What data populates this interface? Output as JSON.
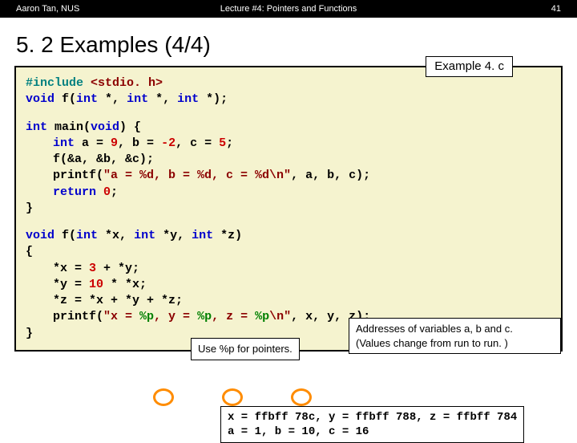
{
  "header": {
    "left": "Aaron Tan, NUS",
    "center": "Lecture #4: Pointers and Functions",
    "right": "41"
  },
  "title": "5. 2 Examples (4/4)",
  "example_label": "Example 4. c",
  "code": {
    "l1a": "#include ",
    "l1b": "<stdio. h>",
    "l2a": "void",
    "l2b": " f(",
    "l2c": "int",
    "l2d": " *, ",
    "l2e": "int",
    "l2f": " *, ",
    "l2g": "int",
    "l2h": " *);",
    "l3a": "int",
    "l3b": " main(",
    "l3c": "void",
    "l3d": ") {",
    "l4a": "int",
    "l4b": " a = ",
    "l4c": "9",
    "l4d": ", b = ",
    "l4e": "-2",
    "l4f": ", c = ",
    "l4g": "5",
    "l4h": ";",
    "l5": "f(&a, &b, &c);",
    "l6a": "printf(",
    "l6b": "\"a = %d, b = %d, c = %d\\n\"",
    "l6c": ", a, b, c);",
    "l7a": "return ",
    "l7b": "0",
    "l7c": ";",
    "l8": "}",
    "l9a": "void",
    "l9b": " f(",
    "l9c": "int",
    "l9d": " *x, ",
    "l9e": "int",
    "l9f": " *y, ",
    "l9g": "int",
    "l9h": " *z)",
    "l10": "{",
    "l11a": "*x = ",
    "l11b": "3",
    "l11c": " + *y;",
    "l12a": "*y = ",
    "l12b": "10",
    "l12c": " * *x;",
    "l13": "*z = *x + *y + *z;",
    "l14a": "printf(",
    "l14b": "\"x = ",
    "l14c": "%p",
    "l14d": ", y = ",
    "l14e": "%p",
    "l14f": ", z = ",
    "l14g": "%p",
    "l14h": "\\n\"",
    "l14i": ", x, y, z);",
    "l15": "}"
  },
  "note1": "Use %p for pointers.",
  "note2a": "Addresses of variables a, b and c.",
  "note2b": "(Values change from run to run. )",
  "output1": "x = ffbff 78c, y = ffbff 788, z = ffbff 784",
  "output2": "a = 1, b = 10, c = 16"
}
